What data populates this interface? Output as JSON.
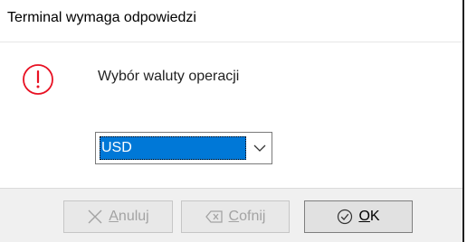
{
  "dialog": {
    "title": "Terminal wymaga odpowiedzi",
    "icon": "warning-circle-icon",
    "message": "Wybór waluty operacji"
  },
  "currency_select": {
    "value": "USD"
  },
  "buttons": {
    "cancel": {
      "label_first": "A",
      "label_rest": "nuluj",
      "state": "disabled",
      "icon": "x-icon"
    },
    "back": {
      "label_first": "C",
      "label_rest": "ofnij",
      "state": "disabled",
      "icon": "backspace-icon"
    },
    "ok": {
      "label_first": "O",
      "label_rest": "K",
      "state": "enabled",
      "icon": "check-circle-icon"
    }
  },
  "colors": {
    "accent": "#0078d7",
    "warning": "#e81123"
  }
}
